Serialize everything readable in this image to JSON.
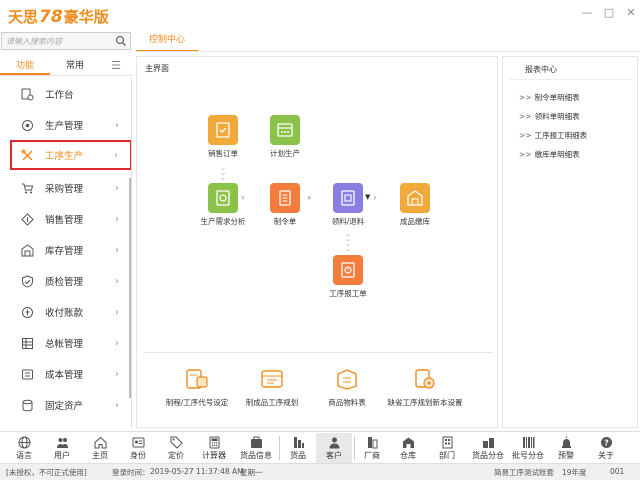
{
  "app": {
    "logo_prefix": "天思",
    "logo_num": "78",
    "logo_suffix": "豪华版"
  },
  "window": {
    "minimize": "—",
    "maximize": "□",
    "close": "✕"
  },
  "search": {
    "placeholder": "请输入搜索内容"
  },
  "left_tabs": [
    {
      "label": "功能"
    },
    {
      "label": "常用"
    }
  ],
  "sidebar": {
    "items": [
      {
        "label": "工作台",
        "icon": "workbench-icon"
      },
      {
        "label": "生产管理",
        "icon": "production-icon"
      },
      {
        "label": "工序生产",
        "icon": "tools-icon"
      },
      {
        "label": "采购管理",
        "icon": "cart-icon"
      },
      {
        "label": "销售管理",
        "icon": "sales-icon"
      },
      {
        "label": "库存管理",
        "icon": "warehouse-icon"
      },
      {
        "label": "质检管理",
        "icon": "shield-check-icon"
      },
      {
        "label": "收付账款",
        "icon": "payment-icon"
      },
      {
        "label": "总帐管理",
        "icon": "ledger-icon"
      },
      {
        "label": "成本管理",
        "icon": "cost-icon"
      },
      {
        "label": "固定资产",
        "icon": "asset-icon"
      }
    ]
  },
  "content_tab": {
    "label": "控制中心"
  },
  "main": {
    "title": "主界面",
    "flow": [
      {
        "label": "销售订单",
        "icon": "sales-order-icon",
        "color": "#f2a93b"
      },
      {
        "label": "计划生产",
        "icon": "plan-icon",
        "color": "#8bc34a"
      },
      {
        "label": "生产需求分析",
        "icon": "analysis-icon",
        "color": "#8bc34a"
      },
      {
        "label": "制令单",
        "icon": "order-icon",
        "color": "#f47c3c"
      },
      {
        "label": "领料/退料",
        "icon": "material-icon",
        "color": "#8a7fe0"
      },
      {
        "label": "成品缴库",
        "icon": "stock-in-icon",
        "color": "#f2a93b"
      },
      {
        "label": "工序报工单",
        "icon": "report-work-icon",
        "color": "#f47c3c"
      }
    ],
    "bottom": [
      {
        "label": "制程/工序代号设定"
      },
      {
        "label": "制成品工序规划"
      },
      {
        "label": "商品物料表"
      },
      {
        "label": "缺省工序规划新本设置"
      }
    ]
  },
  "report": {
    "title": "报表中心",
    "items": [
      "制令单明细表",
      "领料单明细表",
      "工序报工明细表",
      "缴库单明细表"
    ]
  },
  "toolbar": [
    {
      "label": "语言",
      "icon": "language-icon"
    },
    {
      "label": "用户",
      "icon": "users-icon"
    },
    {
      "label": "主页",
      "icon": "home-icon"
    },
    {
      "label": "身份",
      "icon": "identity-icon"
    },
    {
      "label": "定价",
      "icon": "price-tag-icon"
    },
    {
      "label": "计算器",
      "icon": "calculator-icon"
    },
    {
      "label": "货品信息",
      "icon": "goods-info-icon"
    },
    {
      "label": "货品",
      "icon": "goods-icon"
    },
    {
      "label": "客户",
      "icon": "customer-icon"
    },
    {
      "label": "厂商",
      "icon": "vendor-icon"
    },
    {
      "label": "仓库",
      "icon": "warehouse-bar-icon"
    },
    {
      "label": "部门",
      "icon": "department-icon"
    },
    {
      "label": "货品分仓",
      "icon": "goods-split-icon"
    },
    {
      "label": "批号分仓",
      "icon": "batch-icon"
    },
    {
      "label": "预警",
      "icon": "alarm-icon"
    },
    {
      "label": "关于",
      "icon": "help-icon"
    }
  ],
  "status": {
    "license": "[未授权，不可正式使用]",
    "login_label": "登录时间：",
    "login_time": "2019-05-27 11:37:48 AM",
    "weekday": "星期一",
    "account": "简易工序测试账套",
    "year": "19年度",
    "user": "001"
  },
  "colors": {
    "accent": "#f08c1e",
    "selection_border": "#e0292c"
  }
}
